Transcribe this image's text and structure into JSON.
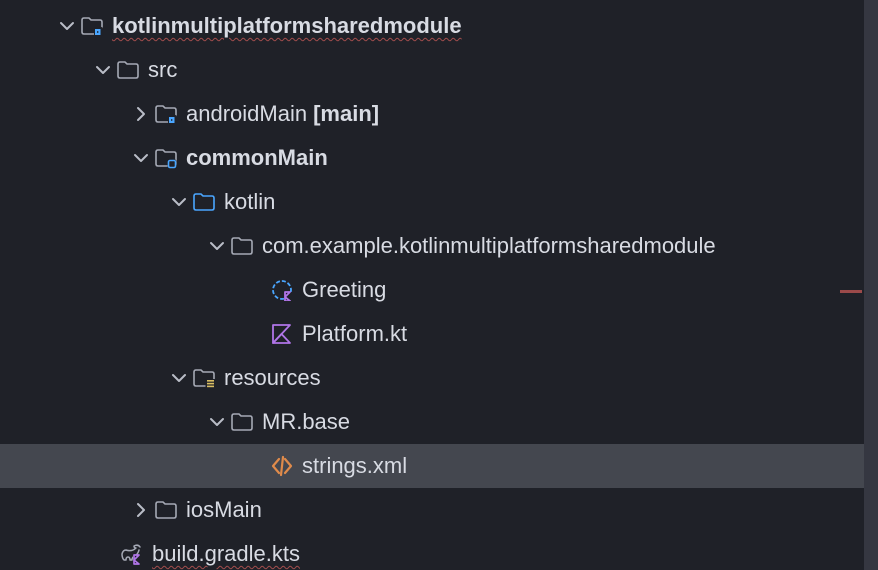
{
  "tree": {
    "root": {
      "label": "kotlinmultiplatformsharedmodule",
      "src": {
        "label": "src"
      },
      "androidMain": {
        "label": "androidMain",
        "suffix": "[main]"
      },
      "commonMain": {
        "label": "commonMain"
      },
      "kotlin": {
        "label": "kotlin"
      },
      "pkg": {
        "label": "com.example.kotlinmultiplatformsharedmodule"
      },
      "greeting": {
        "label": "Greeting"
      },
      "platform": {
        "label": "Platform.kt"
      },
      "resources": {
        "label": "resources"
      },
      "mrbase": {
        "label": "MR.base"
      },
      "strings": {
        "label": "strings.xml"
      },
      "iosMain": {
        "label": "iosMain"
      },
      "build": {
        "label": "build.gradle.kts"
      }
    }
  },
  "icons": {
    "chevron_down": "chevron-down-icon",
    "chevron_right": "chevron-right-icon",
    "folder": "folder-icon",
    "module_folder": "module-folder-icon",
    "source_folder": "source-folder-icon",
    "resources_folder": "resources-folder-icon",
    "package_folder": "package-folder-icon",
    "kotlin_class": "kotlin-class-icon",
    "kotlin_file": "kotlin-file-icon",
    "xml_file": "xml-file-icon",
    "gradle_file": "gradle-file-icon"
  },
  "colors": {
    "bg": "#1f2128",
    "selected": "#44474f",
    "text": "#d8dbe3",
    "scrollbar": "#353741",
    "accent_blue": "#4aa6ff",
    "accent_purple": "#b075e8",
    "accent_orange": "#e08b4b",
    "accent_yellow": "#d9be63",
    "spell": "#a34d4d"
  }
}
